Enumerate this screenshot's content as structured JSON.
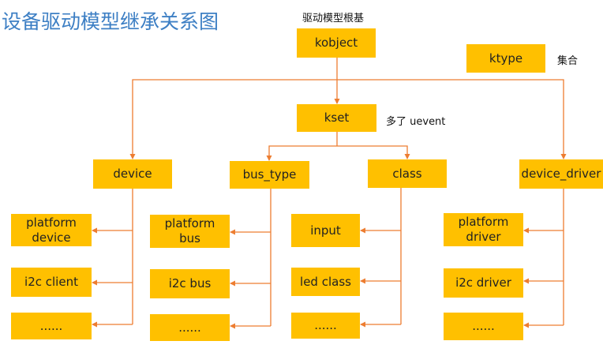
{
  "title": "设备驱动模型继承关系图",
  "annotations": {
    "root_caption": "驱动模型根基",
    "ktype_caption": "集合",
    "kset_caption": "多了 uevent"
  },
  "colors": {
    "box": "#ffc000",
    "line": "#ed7d31",
    "title": "#3d7fc4"
  },
  "nodes": {
    "kobject": "kobject",
    "ktype": "ktype",
    "kset": "kset",
    "device": "device",
    "bus_type": "bus_type",
    "class": "class",
    "device_driver": "device_driver",
    "platform_device": "platform\ndevice",
    "i2c_client": "i2c client",
    "device_more": "......",
    "platform_bus": "platform\nbus",
    "i2c_bus": "i2c bus",
    "bus_more": "......",
    "input": "input",
    "led_class": "led class",
    "class_more": "......",
    "platform_driver": "platform\ndriver",
    "i2c_driver": "i2c driver",
    "driver_more": "......"
  }
}
